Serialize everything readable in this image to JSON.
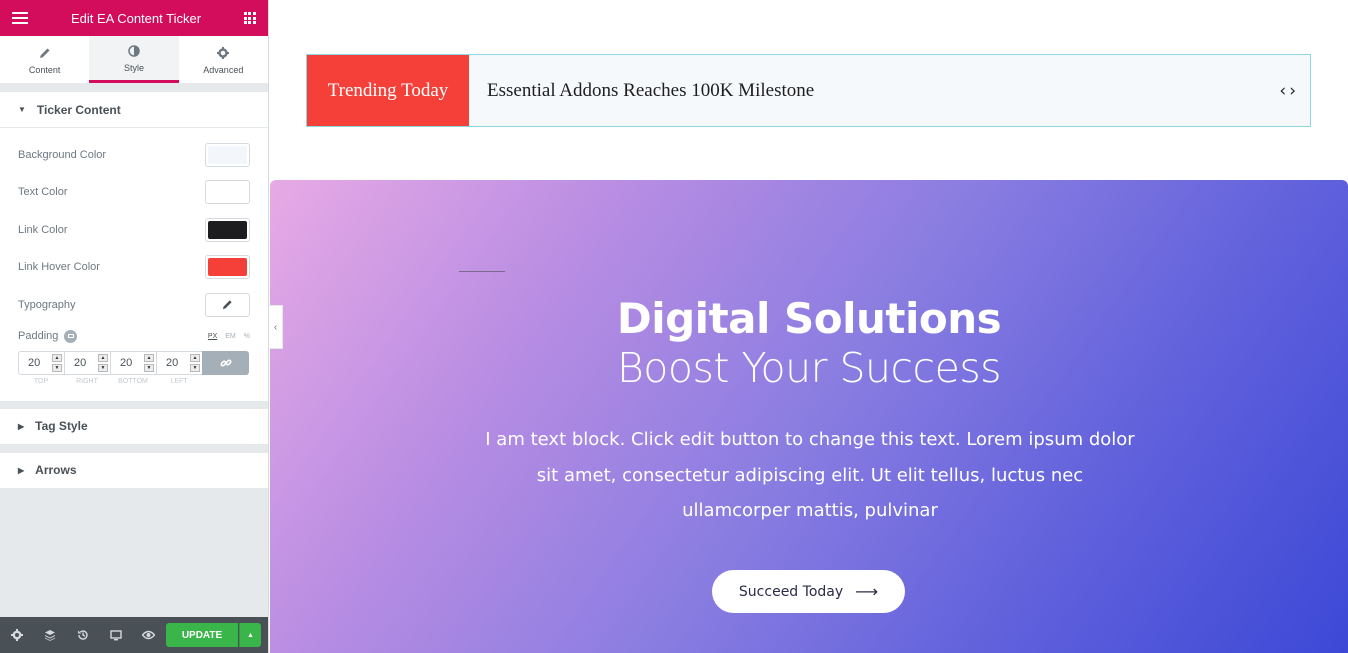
{
  "sidebar": {
    "header_title": "Edit EA Content Ticker",
    "tabs": [
      {
        "label": "Content",
        "icon": "pencil-icon"
      },
      {
        "label": "Style",
        "icon": "contrast-icon"
      },
      {
        "label": "Advanced",
        "icon": "gear-icon"
      }
    ],
    "ticker_content": {
      "title": "Ticker Content",
      "rows": [
        {
          "label": "Background Color",
          "color": "#f3f6fb"
        },
        {
          "label": "Text Color",
          "color": "#ffffff"
        },
        {
          "label": "Link Color",
          "color": "#1d1d1f"
        },
        {
          "label": "Link Hover Color",
          "color": "#f5403a"
        }
      ],
      "typography_label": "Typography",
      "padding": {
        "label": "Padding",
        "units": [
          "PX",
          "EM",
          "%"
        ],
        "values": [
          "20",
          "20",
          "20",
          "20"
        ],
        "sides": [
          "TOP",
          "RIGHT",
          "BOTTOM",
          "LEFT"
        ]
      }
    },
    "tag_style_title": "Tag Style",
    "arrows_title": "Arrows",
    "footer": {
      "update_label": "UPDATE"
    }
  },
  "ticker": {
    "tag": "Trending Today",
    "text": "Essential Addons Reaches 100K Milestone",
    "prev": "‹",
    "next": "›"
  },
  "hero": {
    "title": "Digital Solutions",
    "subtitle": "Boost Your Success",
    "text": "I am text block. Click edit button to change this text. Lorem ipsum dolor sit amet, consectetur adipiscing elit. Ut elit tellus, luctus nec ullamcorper mattis, pulvinar",
    "button_label": "Succeed Today",
    "button_arrow": "⟶"
  },
  "colors": {
    "brand": "#d30c5c",
    "update": "#39b54a",
    "ticker_tag": "#f5403a"
  }
}
